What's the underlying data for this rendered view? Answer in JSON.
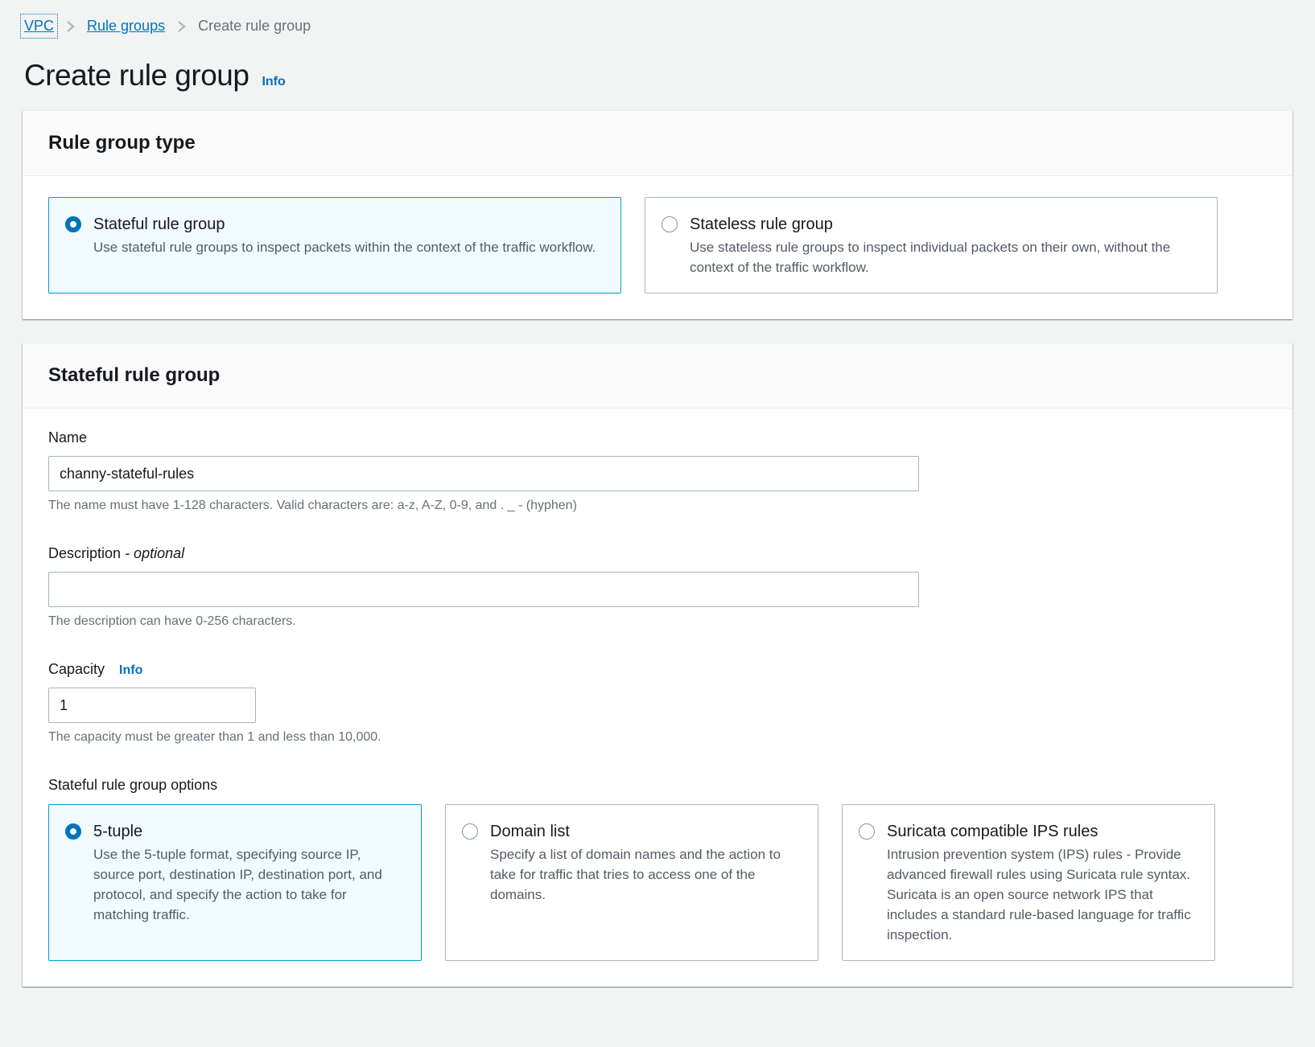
{
  "breadcrumb": {
    "items": [
      {
        "label": "VPC"
      },
      {
        "label": "Rule groups"
      },
      {
        "label": "Create rule group"
      }
    ]
  },
  "page": {
    "title": "Create rule group",
    "info_label": "Info"
  },
  "rule_group_type_section": {
    "title": "Rule group type",
    "options": [
      {
        "label": "Stateful rule group",
        "description": "Use stateful rule groups to inspect packets within the context of the traffic workflow.",
        "selected": true
      },
      {
        "label": "Stateless rule group",
        "description": "Use stateless rule groups to inspect individual packets on their own, without the context of the traffic workflow.",
        "selected": false
      }
    ]
  },
  "stateful_section": {
    "title": "Stateful rule group",
    "name_field": {
      "label": "Name",
      "value": "channy-stateful-rules",
      "hint": "The name must have 1-128 characters. Valid characters are: a-z, A-Z, 0-9, and . _ - (hyphen)"
    },
    "description_field": {
      "label": "Description",
      "optional_suffix": "- optional",
      "value": "",
      "hint": "The description can have 0-256 characters."
    },
    "capacity_field": {
      "label": "Capacity",
      "info_label": "Info",
      "value": "1",
      "hint": "The capacity must be greater than 1 and less than 10,000."
    },
    "options_label": "Stateful rule group options",
    "options": [
      {
        "label": "5-tuple",
        "description": "Use the 5-tuple format, specifying source IP, source port, destination IP, destination port, and protocol, and specify the action to take for matching traffic.",
        "selected": true
      },
      {
        "label": "Domain list",
        "description": "Specify a list of domain names and the action to take for traffic that tries to access one of the domains.",
        "selected": false
      },
      {
        "label": "Suricata compatible IPS rules",
        "description": "Intrusion prevention system (IPS) rules - Provide advanced firewall rules using Suricata rule syntax. Suricata is an open source network IPS that includes a standard rule-based language for traffic inspection.",
        "selected": false
      }
    ]
  },
  "colors": {
    "link_blue": "#0073bb",
    "selected_tile_bg": "#f1faff",
    "selected_tile_border": "#00a1c9",
    "page_bg": "#f2f3f3",
    "hint_gray": "#687078",
    "desc_gray": "#545b64",
    "text_dark": "#16191f"
  }
}
